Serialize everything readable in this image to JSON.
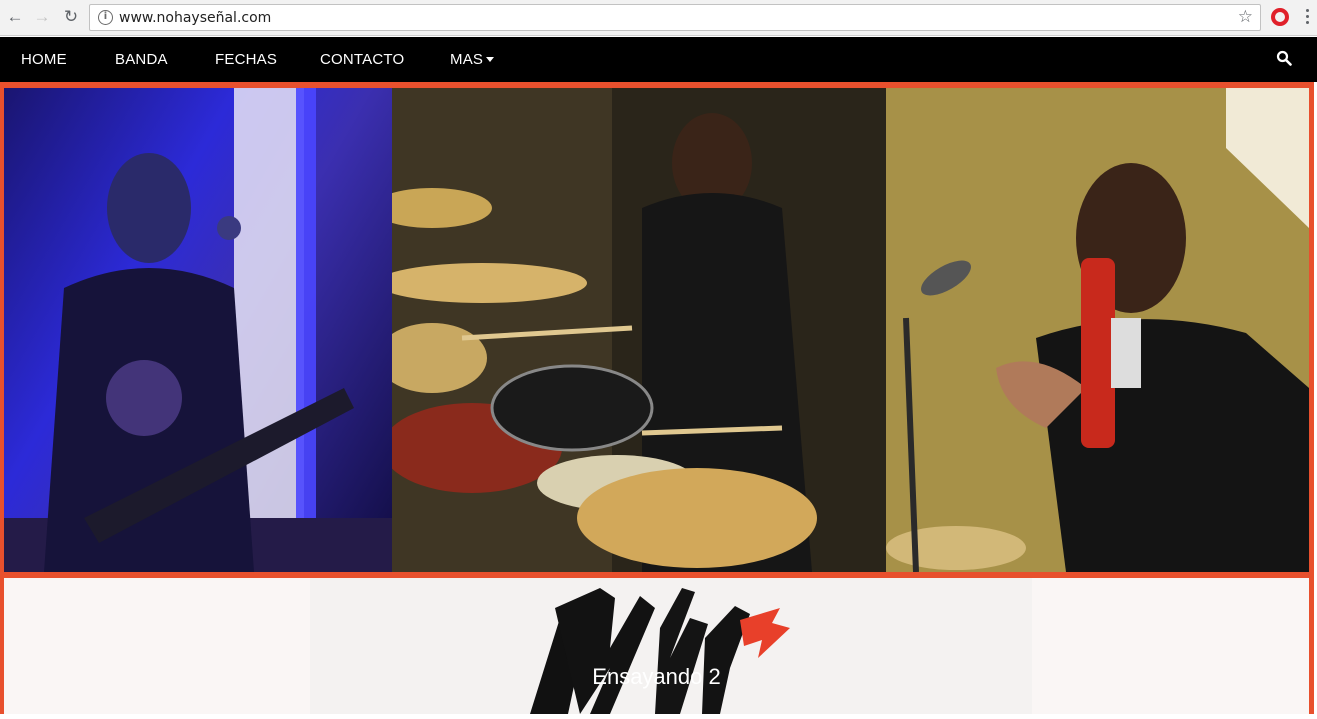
{
  "browser": {
    "url": "www.nohayseñal.com",
    "icons": [
      "back-icon",
      "forward-icon",
      "reload-icon",
      "info-icon",
      "star-icon",
      "opera-icon",
      "menu-icon"
    ]
  },
  "nav": {
    "items": [
      {
        "label": "HOME"
      },
      {
        "label": "BANDA"
      },
      {
        "label": "FECHAS"
      },
      {
        "label": "CONTACTO"
      },
      {
        "label": "MAS"
      }
    ],
    "search_icon": "search-icon"
  },
  "hero": {
    "panels": [
      "bassist photo",
      "drummer photo",
      "guitarist photo"
    ]
  },
  "lower": {
    "logo": "NH logo",
    "caption": "Ensayando 2"
  },
  "colors": {
    "frame": "#e8502d",
    "nav_bg": "#000000",
    "logo_accent": "#e8402a"
  }
}
